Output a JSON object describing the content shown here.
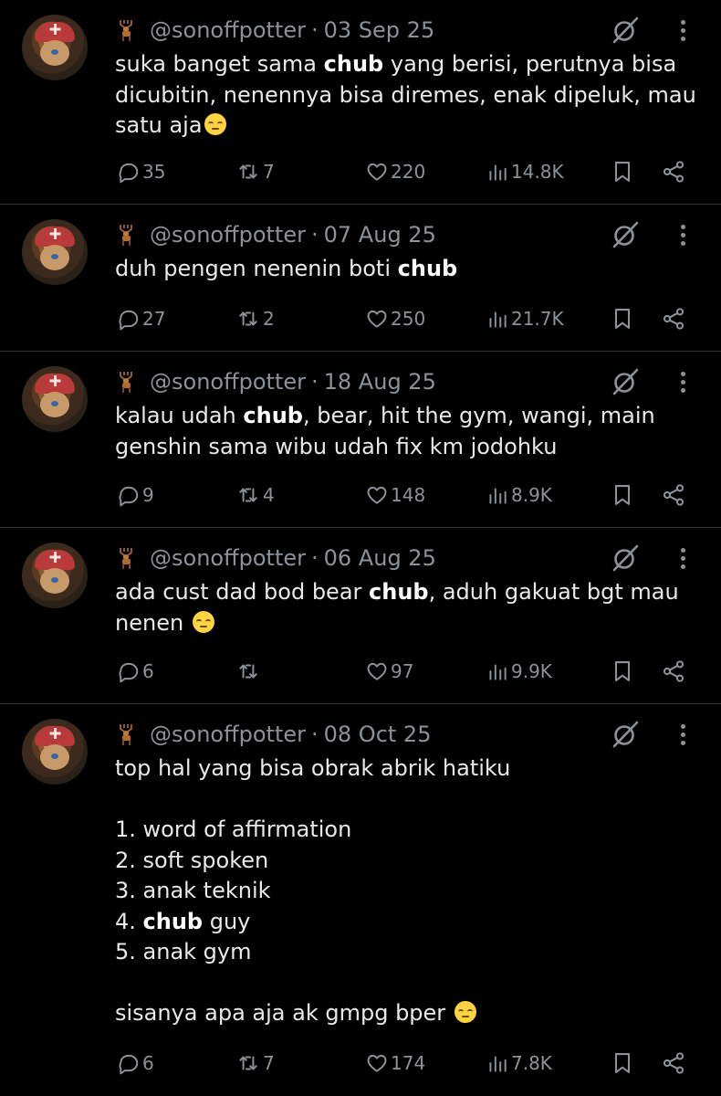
{
  "tweets": [
    {
      "handle": "@sonoffpotter",
      "date": "03 Sep 25",
      "lines": [
        [
          {
            "t": "suka banget sama "
          },
          {
            "t": "chub",
            "b": true
          },
          {
            "t": " yang berisi, perutnya bisa"
          }
        ],
        [
          {
            "t": "dicubitin, nenennya bisa diremes, enak dipeluk, mau"
          }
        ],
        [
          {
            "t": "satu aja"
          },
          {
            "emoji": "pensive-face"
          }
        ]
      ],
      "replies": "35",
      "reposts": "7",
      "likes": "220",
      "views": "14.8K"
    },
    {
      "handle": "@sonoffpotter",
      "date": "07 Aug 25",
      "lines": [
        [
          {
            "t": "duh pengen nenenin boti "
          },
          {
            "t": "chub",
            "b": true
          }
        ]
      ],
      "replies": "27",
      "reposts": "2",
      "likes": "250",
      "views": "21.7K"
    },
    {
      "handle": "@sonoffpotter",
      "date": "18 Aug 25",
      "lines": [
        [
          {
            "t": "kalau udah "
          },
          {
            "t": "chub",
            "b": true
          },
          {
            "t": ", bear, hit the gym, wangi, main"
          }
        ],
        [
          {
            "t": "genshin sama wibu udah fix km jodohku"
          }
        ]
      ],
      "replies": "9",
      "reposts": "4",
      "likes": "148",
      "views": "8.9K"
    },
    {
      "handle": "@sonoffpotter",
      "date": "06 Aug 25",
      "lines": [
        [
          {
            "t": "ada cust dad bod bear "
          },
          {
            "t": "chub",
            "b": true
          },
          {
            "t": ", aduh gakuat bgt mau"
          }
        ],
        [
          {
            "t": "nenen "
          },
          {
            "emoji": "pensive-face"
          }
        ]
      ],
      "replies": "6",
      "reposts": "",
      "likes": "97",
      "views": "9.9K"
    },
    {
      "handle": "@sonoffpotter",
      "date": "08 Oct 25",
      "lines": [
        [
          {
            "t": "top hal yang bisa obrak abrik hatiku"
          }
        ],
        [],
        [
          {
            "t": "1. word of affirmation"
          }
        ],
        [
          {
            "t": "2. soft spoken"
          }
        ],
        [
          {
            "t": "3. anak teknik"
          }
        ],
        [
          {
            "t": "4. "
          },
          {
            "t": "chub",
            "b": true
          },
          {
            "t": " guy"
          }
        ],
        [
          {
            "t": "5. anak gym"
          }
        ],
        [],
        [
          {
            "t": "sisanya apa aja ak gmpg bper "
          },
          {
            "emoji": "pensive-face"
          }
        ]
      ],
      "replies": "6",
      "reposts": "7",
      "likes": "174",
      "views": "7.8K"
    }
  ],
  "colors": {
    "background": "#000000",
    "text": "#e7e9ea",
    "muted": "#8b9399",
    "divider": "#2f3336"
  },
  "icons": [
    "deer-emoji-icon",
    "grok-icon",
    "more-icon",
    "reply-icon",
    "repost-icon",
    "like-icon",
    "views-icon",
    "bookmark-icon",
    "share-icon",
    "pensive-face-emoji"
  ]
}
